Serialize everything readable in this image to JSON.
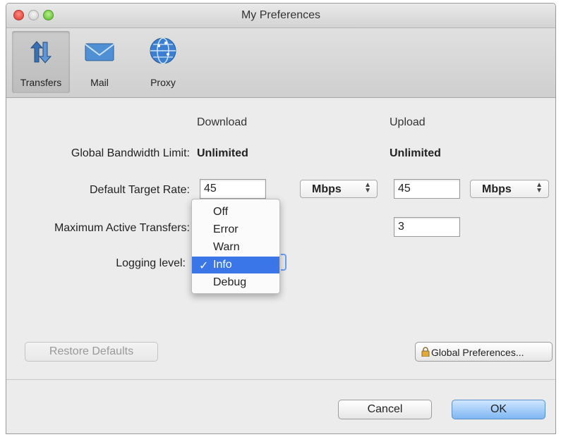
{
  "window": {
    "title": "My Preferences"
  },
  "toolbar": {
    "items": [
      {
        "label": "Transfers",
        "icon": "transfers-icon",
        "selected": true
      },
      {
        "label": "Mail",
        "icon": "mail-icon",
        "selected": false
      },
      {
        "label": "Proxy",
        "icon": "proxy-globe-icon",
        "selected": false
      }
    ]
  },
  "columns": {
    "download": "Download",
    "upload": "Upload"
  },
  "rows": {
    "global_bandwidth": {
      "label": "Global Bandwidth Limit:",
      "download": "Unlimited",
      "upload": "Unlimited"
    },
    "default_target": {
      "label": "Default Target Rate:",
      "download_value": "45",
      "download_unit": "Mbps",
      "upload_value": "45",
      "upload_unit": "Mbps"
    },
    "max_active": {
      "label": "Maximum Active Transfers:",
      "upload_value": "3"
    },
    "logging": {
      "label": "Logging level:",
      "selected": "Info"
    }
  },
  "logging_menu": {
    "options": [
      "Off",
      "Error",
      "Warn",
      "Info",
      "Debug"
    ],
    "check_glyph": "✓"
  },
  "buttons": {
    "restore": "Restore Defaults",
    "global": "Global Preferences...",
    "cancel": "Cancel",
    "ok": "OK"
  },
  "colors": {
    "selection": "#3a76e8",
    "ok_button": "#7fb7f2"
  }
}
